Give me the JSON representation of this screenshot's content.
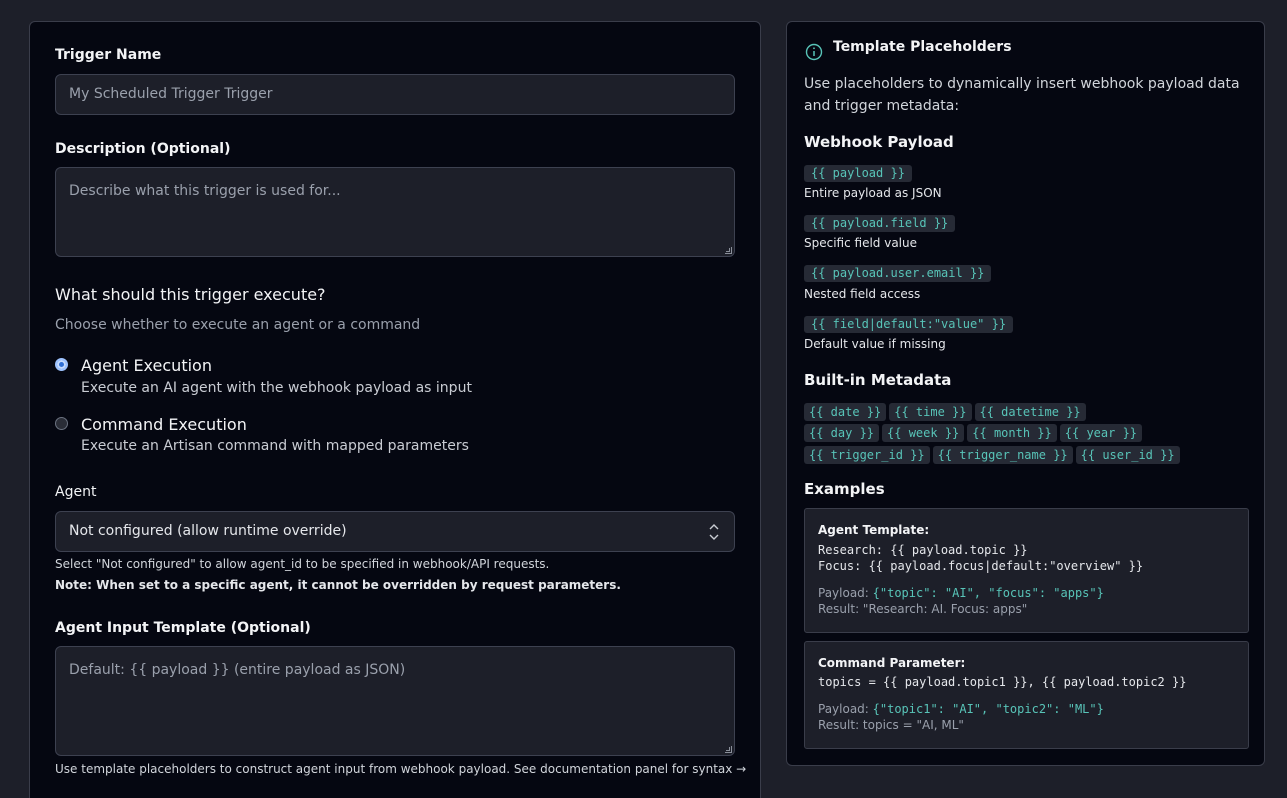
{
  "form": {
    "trigger_name": {
      "label": "Trigger Name",
      "value": "My Scheduled Trigger Trigger"
    },
    "description": {
      "label": "Description (Optional)",
      "placeholder": "Describe what this trigger is used for..."
    },
    "execute": {
      "title": "What should this trigger execute?",
      "subtitle": "Choose whether to execute an agent or a command",
      "options": [
        {
          "title": "Agent Execution",
          "desc": "Execute an AI agent with the webhook payload as input",
          "selected": true
        },
        {
          "title": "Command Execution",
          "desc": "Execute an Artisan command with mapped parameters",
          "selected": false
        }
      ]
    },
    "agent": {
      "label": "Agent",
      "selected": "Not configured (allow runtime override)",
      "help": "Select \"Not configured\" to allow agent_id to be specified in webhook/API requests.",
      "note": "Note: When set to a specific agent, it cannot be overridden by request parameters."
    },
    "agent_input": {
      "label": "Agent Input Template (Optional)",
      "placeholder": "Default: {{ payload }} (entire payload as JSON)",
      "help": "Use template placeholders to construct agent input from webhook payload. See documentation panel for syntax →"
    }
  },
  "docs": {
    "title": "Template Placeholders",
    "intro_line1": "Use placeholders to dynamically insert webhook payload data",
    "intro_line2": "and trigger metadata:",
    "webhook_heading": "Webhook Payload",
    "webhook": [
      {
        "code": "{{ payload }}",
        "desc": "Entire payload as JSON"
      },
      {
        "code": "{{ payload.field }}",
        "desc": "Specific field value"
      },
      {
        "code": "{{ payload.user.email }}",
        "desc": "Nested field access"
      },
      {
        "code": "{{ field|default:\"value\" }}",
        "desc": "Default value if missing"
      }
    ],
    "metadata_heading": "Built-in Metadata",
    "metadata_rows": [
      [
        "{{ date }}",
        "{{ time }}",
        "{{ datetime }}"
      ],
      [
        "{{ day }}",
        "{{ week }}",
        "{{ month }}",
        "{{ year }}"
      ],
      [
        "{{ trigger_id }}",
        "{{ trigger_name }}",
        "{{ user_id }}"
      ]
    ],
    "examples_heading": "Examples",
    "example_agent": {
      "title": "Agent Template:",
      "line1": "Research: {{ payload.topic }}",
      "line2": "Focus: {{ payload.focus|default:\"overview\" }}",
      "payload_label": "Payload: ",
      "payload": "{\"topic\": \"AI\", \"focus\": \"apps\"}",
      "result": "Result: \"Research: AI. Focus: apps\""
    },
    "example_command": {
      "title": "Command Parameter:",
      "line1": "topics = {{ payload.topic1 }}, {{ payload.topic2 }}",
      "payload_label": "Payload: ",
      "payload": "{\"topic1\": \"AI\", \"topic2\": \"ML\"}",
      "result": "Result: topics = \"AI, ML\""
    }
  }
}
